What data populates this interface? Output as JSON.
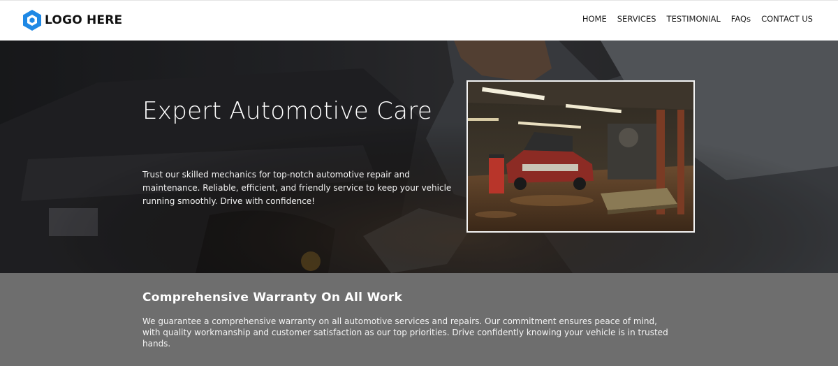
{
  "header": {
    "logo_text": "LOGO HERE",
    "logo_icon": "hexagon-logo-icon",
    "brand_color": "#1e88e5",
    "nav": [
      "HOME",
      "SERVICES",
      "TESTIMONIAL",
      "FAQs",
      "CONTACT US"
    ]
  },
  "hero": {
    "title": "Expert Automotive Care",
    "text": "Trust our skilled mechanics for top-notch automotive repair and maintenance. Reliable, efficient, and friendly service to keep your vehicle running smoothly. Drive with confidence!",
    "background_image": "mechanic-working-on-engine",
    "photo": "auto-repair-garage-with-red-classic-car"
  },
  "warranty": {
    "title": "Comprehensive Warranty On All Work",
    "text": "We guarantee a comprehensive warranty on all automotive services and repairs. Our commitment ensures peace of mind, with quality workmanship and customer satisfaction as our top priorities. Drive confidently knowing your vehicle is in trusted hands.",
    "background_color": "#6e6e6e"
  }
}
